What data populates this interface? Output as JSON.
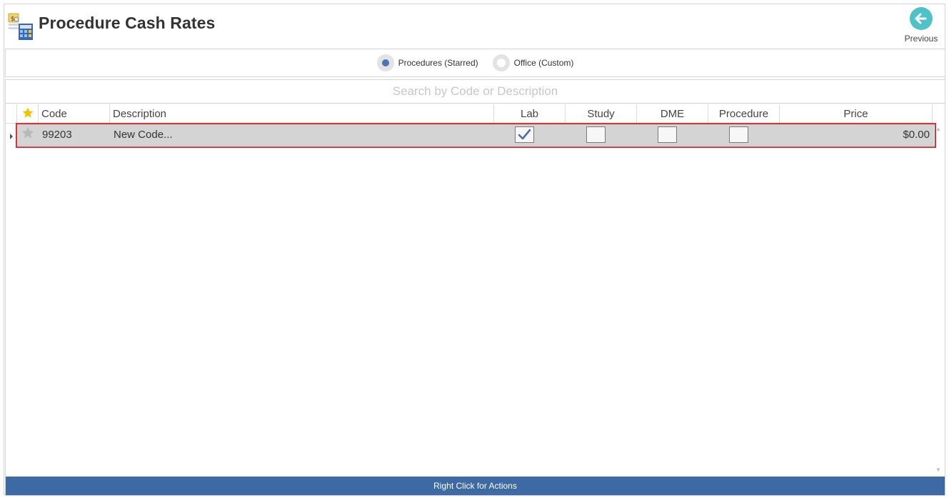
{
  "header": {
    "title": "Procedure Cash Rates",
    "previous_label": "Previous"
  },
  "filter": {
    "options": [
      {
        "label": "Procedures (Starred)",
        "selected": true
      },
      {
        "label": "Office (Custom)",
        "selected": false
      }
    ]
  },
  "search": {
    "placeholder": "Search by Code or Description"
  },
  "grid": {
    "columns": {
      "star": "star-icon",
      "code": "Code",
      "description": "Description",
      "lab": "Lab",
      "study": "Study",
      "dme": "DME",
      "procedure": "Procedure",
      "price": "Price"
    },
    "rows": [
      {
        "starred": false,
        "code": "99203",
        "description": "New Code...",
        "lab": true,
        "study": false,
        "dme": false,
        "procedure": false,
        "price": "$0.00"
      }
    ]
  },
  "footer": {
    "label": "Right Click for Actions"
  },
  "colors": {
    "accent": "#3d6aa5",
    "previous_button": "#4fc1c9",
    "star_header": "#f2c200",
    "highlight": "#e0303a"
  }
}
